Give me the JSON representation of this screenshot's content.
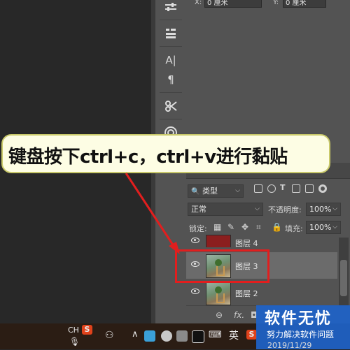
{
  "properties": {
    "x_label": "X:",
    "x_value": "0 厘米",
    "y_label": "Y:",
    "y_value": "0 厘米"
  },
  "toolbar": {
    "tools": [
      "adjust-icon",
      "properties-icon",
      "character-icon",
      "paragraph-icon",
      "brushes-icon",
      "libraries-icon"
    ],
    "char_glyph": "A|",
    "para_glyph": "¶"
  },
  "layers": {
    "filter_kind": "类型",
    "blend_mode": "正常",
    "opacity_label": "不透明度:",
    "opacity_value": "100%",
    "lock_label": "锁定:",
    "fill_label": "填充:",
    "fill_value": "100%",
    "items": [
      {
        "name": "图层 4",
        "partial": true
      },
      {
        "name": "图层 3",
        "selected": true
      },
      {
        "name": "图层 2"
      }
    ],
    "footer": {
      "link": "⊖",
      "fx": "fx.",
      "mask": "◘"
    }
  },
  "callout": {
    "text": "键盘按下ctrl+c，ctrl+v进行黏贴",
    "color": "#e21e1e"
  },
  "taskbar": {
    "lang": "CH",
    "ime": "英",
    "sogou": "S"
  },
  "watermark": {
    "title": "软件无忧",
    "subtitle": "努力解决软件问题",
    "date": "2019/11/29"
  }
}
